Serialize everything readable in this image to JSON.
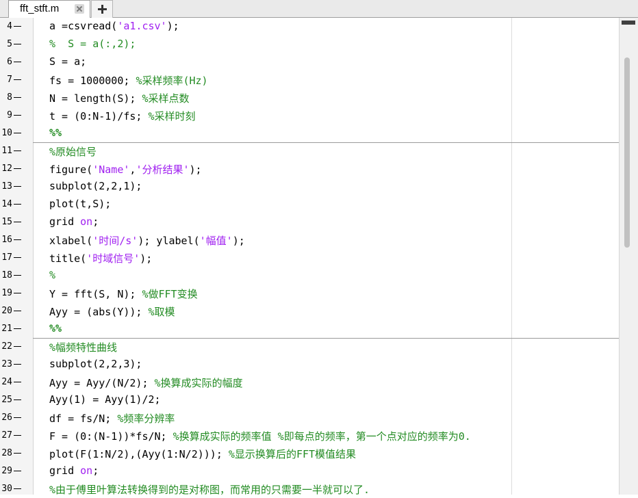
{
  "tab": {
    "title": "fft_stft.m"
  },
  "lines": [
    {
      "num": "4",
      "segs": [
        {
          "t": "a =csvread(",
          "c": "p"
        },
        {
          "t": "'a1.csv'",
          "c": "str"
        },
        {
          "t": ");",
          "c": "p"
        }
      ]
    },
    {
      "num": "5",
      "segs": [
        {
          "t": "%  S = a(:,2);",
          "c": "com"
        }
      ]
    },
    {
      "num": "6",
      "segs": [
        {
          "t": "S = a;",
          "c": "p"
        }
      ]
    },
    {
      "num": "7",
      "segs": [
        {
          "t": "fs = 1000000; ",
          "c": "p"
        },
        {
          "t": "%采样频率(Hz)",
          "c": "com"
        }
      ]
    },
    {
      "num": "8",
      "segs": [
        {
          "t": "N = length(S); ",
          "c": "p"
        },
        {
          "t": "%采样点数",
          "c": "com"
        }
      ]
    },
    {
      "num": "9",
      "segs": [
        {
          "t": "t = (0:N-1)/fs; ",
          "c": "p"
        },
        {
          "t": "%采样时刻",
          "c": "com"
        }
      ]
    },
    {
      "num": "10",
      "segs": [
        {
          "t": "%%",
          "c": "cell"
        }
      ]
    },
    {
      "num": "11",
      "segs": [
        {
          "t": "%原始信号",
          "c": "com"
        }
      ]
    },
    {
      "num": "12",
      "segs": [
        {
          "t": "figure(",
          "c": "p"
        },
        {
          "t": "'Name'",
          "c": "str"
        },
        {
          "t": ",",
          "c": "p"
        },
        {
          "t": "'分析结果'",
          "c": "str"
        },
        {
          "t": ");",
          "c": "p"
        }
      ]
    },
    {
      "num": "13",
      "segs": [
        {
          "t": "subplot(2,2,1);",
          "c": "p"
        }
      ]
    },
    {
      "num": "14",
      "segs": [
        {
          "t": "plot(t,S);",
          "c": "p"
        }
      ]
    },
    {
      "num": "15",
      "segs": [
        {
          "t": "grid ",
          "c": "p"
        },
        {
          "t": "on",
          "c": "str"
        },
        {
          "t": ";",
          "c": "p"
        }
      ]
    },
    {
      "num": "16",
      "segs": [
        {
          "t": "xlabel(",
          "c": "p"
        },
        {
          "t": "'时间/s'",
          "c": "str"
        },
        {
          "t": "); ylabel(",
          "c": "p"
        },
        {
          "t": "'幅值'",
          "c": "str"
        },
        {
          "t": ");",
          "c": "p"
        }
      ]
    },
    {
      "num": "17",
      "segs": [
        {
          "t": "title(",
          "c": "p"
        },
        {
          "t": "'时域信号'",
          "c": "str"
        },
        {
          "t": ");",
          "c": "p"
        }
      ]
    },
    {
      "num": "18",
      "segs": [
        {
          "t": "%",
          "c": "com"
        }
      ]
    },
    {
      "num": "19",
      "segs": [
        {
          "t": "Y = fft(S, N); ",
          "c": "p"
        },
        {
          "t": "%做FFT变换",
          "c": "com"
        }
      ]
    },
    {
      "num": "20",
      "segs": [
        {
          "t": "Ayy = (abs(Y)); ",
          "c": "p"
        },
        {
          "t": "%取模",
          "c": "com"
        }
      ]
    },
    {
      "num": "21",
      "segs": [
        {
          "t": "%%",
          "c": "cell"
        }
      ]
    },
    {
      "num": "22",
      "segs": [
        {
          "t": "%幅频特性曲线",
          "c": "com"
        }
      ]
    },
    {
      "num": "23",
      "segs": [
        {
          "t": "subplot(2,2,3);",
          "c": "p"
        }
      ]
    },
    {
      "num": "24",
      "segs": [
        {
          "t": "Ayy = Ayy/(N/2); ",
          "c": "p"
        },
        {
          "t": "%换算成实际的幅度",
          "c": "com"
        }
      ]
    },
    {
      "num": "25",
      "segs": [
        {
          "t": "Ayy(1) = Ayy(1)/2;",
          "c": "p"
        }
      ]
    },
    {
      "num": "26",
      "segs": [
        {
          "t": "df = fs/N; ",
          "c": "p"
        },
        {
          "t": "%频率分辨率",
          "c": "com"
        }
      ]
    },
    {
      "num": "27",
      "segs": [
        {
          "t": "F = (0:(N-1))*fs/N; ",
          "c": "p"
        },
        {
          "t": "%换算成实际的频率值 %即每点的频率，第一个点对应的频率为0.",
          "c": "com"
        }
      ]
    },
    {
      "num": "28",
      "segs": [
        {
          "t": "plot(F(1:N/2),(Ayy(1:N/2))); ",
          "c": "p"
        },
        {
          "t": "%显示换算后的FFT模值结果",
          "c": "com"
        }
      ]
    },
    {
      "num": "29",
      "segs": [
        {
          "t": "grid ",
          "c": "p"
        },
        {
          "t": "on",
          "c": "str"
        },
        {
          "t": ";",
          "c": "p"
        }
      ]
    },
    {
      "num": "30",
      "segs": [
        {
          "t": "%由于傅里叶算法转换得到的是对称图，而常用的只需要一半就可以了.",
          "c": "com"
        }
      ]
    }
  ]
}
